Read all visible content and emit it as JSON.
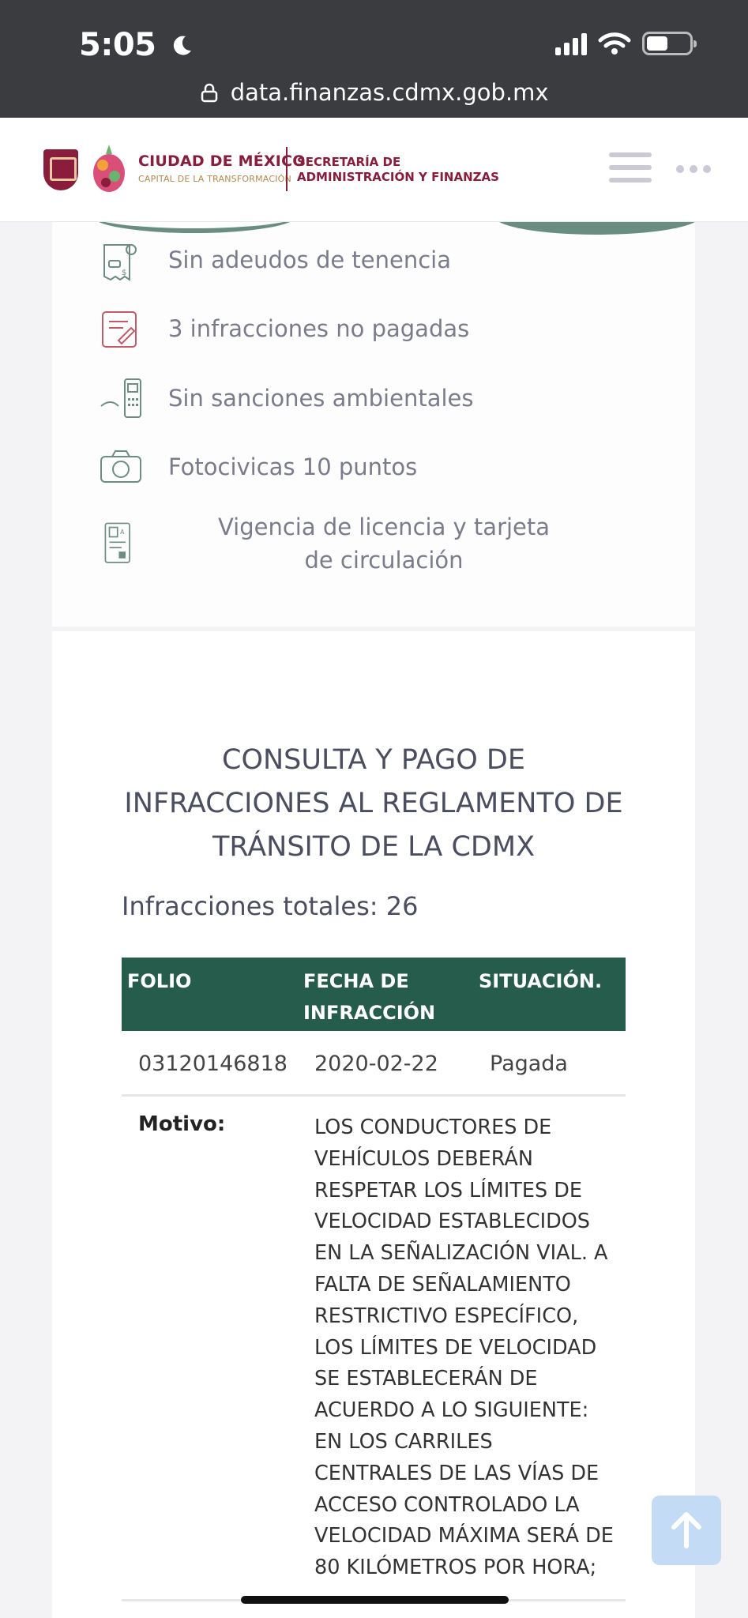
{
  "status_bar": {
    "time": "5:05"
  },
  "browser": {
    "url": "data.finanzas.cdmx.gob.mx"
  },
  "header": {
    "logo_title": "CIUDAD DE MÉXICO",
    "logo_subtitle": "CAPITAL DE LA TRANSFORMACIÓN",
    "secretaria_line1": "SECRETARÍA DE",
    "secretaria_line2": "ADMINISTRACIÓN Y FINANZAS"
  },
  "features": [
    {
      "icon": "receipt-car-icon",
      "label": "Sin adeudos de tenencia"
    },
    {
      "icon": "ticket-pen-icon",
      "label": "3 infracciones no pagadas"
    },
    {
      "icon": "terminal-icon",
      "label": "Sin sanciones ambientales"
    },
    {
      "icon": "camera-icon",
      "label": "Fotocivicas 10 puntos"
    },
    {
      "icon": "license-card-icon",
      "label": "Vigencia de licencia y tarjeta de circulación"
    }
  ],
  "section": {
    "title": "CONSULTA Y PAGO DE INFRACCIONES AL REGLAMENTO DE TRÁNSITO DE LA CDMX",
    "total_label": "Infracciones totales: 26"
  },
  "table": {
    "headers": {
      "folio": "FOLIO",
      "fecha_line1": "FECHA DE",
      "fecha_line2": "INFRACCIÓN",
      "situacion": "SITUACIÓN."
    },
    "rows": [
      {
        "folio": "03120146818",
        "fecha": "2020-02-22",
        "situacion": "Pagada"
      }
    ],
    "motivo_label": "Motivo:",
    "motivo_text": "LOS CONDUCTORES DE VEHÍCULOS DEBERÁN RESPETAR LOS LÍMITES DE VELOCIDAD ESTABLECIDOS EN LA SEÑALIZACIÓN VIAL. A FALTA DE SEÑALAMIENTO RESTRICTIVO ESPECÍFICO, LOS LÍMITES DE VELOCIDAD SE ESTABLECERÁN DE ACUERDO A LO SIGUIENTE: EN LOS CARRILES CENTRALES DE LAS VÍAS DE ACCESO CONTROLADO LA VELOCIDAD MÁXIMA SERÁ DE 80 KILÓMETROS POR HORA;"
  },
  "colors": {
    "header_green": "#255c4b",
    "brand_maroon": "#8a1c3c",
    "scroll_top_button": "#c4dbf6"
  }
}
